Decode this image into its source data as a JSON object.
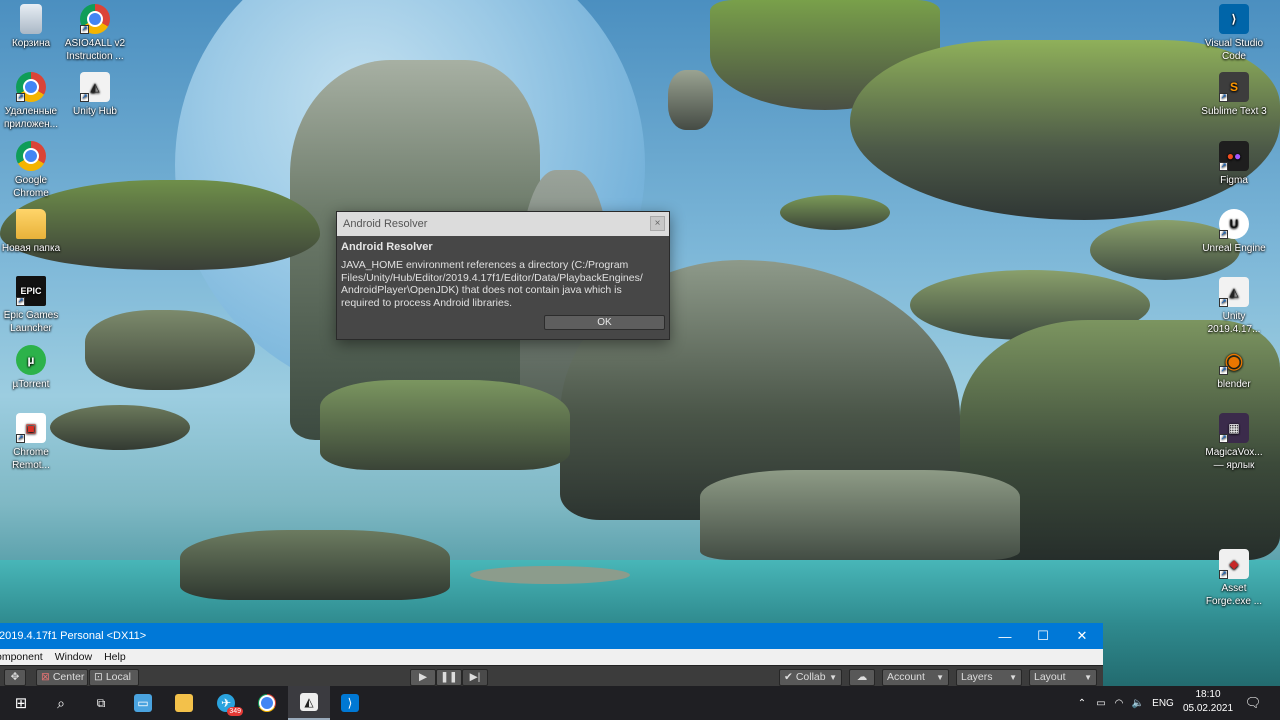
{
  "desktop": {
    "left_icons": [
      {
        "label": "Корзина",
        "icon": "recycle-bin-icon"
      },
      {
        "label": "Удаленные приложен...",
        "icon": "chrome-apps-icon"
      },
      {
        "label": "Google Chrome",
        "icon": "chrome-icon"
      },
      {
        "label": "Новая папка",
        "icon": "folder-icon"
      },
      {
        "label": "Epic Games Launcher",
        "icon": "epic-games-icon"
      },
      {
        "label": "µTorrent",
        "icon": "utorrent-icon"
      },
      {
        "label": "Chrome Remot...",
        "icon": "chrome-remote-icon"
      }
    ],
    "second_column_icons": [
      {
        "label": "ASIO4ALL v2 Instruction ...",
        "icon": "asio-chrome-icon"
      },
      {
        "label": "Unity Hub",
        "icon": "unity-hub-icon"
      }
    ],
    "right_icons": [
      {
        "label": "Visual Studio Code",
        "icon": "vscode-icon"
      },
      {
        "label": "Sublime Text 3",
        "icon": "sublime-icon"
      },
      {
        "label": "Figma",
        "icon": "figma-icon"
      },
      {
        "label": "Unreal Engine",
        "icon": "unreal-icon"
      },
      {
        "label": "Unity 2019.4.17...",
        "icon": "unity-icon"
      },
      {
        "label": "blender",
        "icon": "blender-icon"
      },
      {
        "label": "MagicaVox... — ярлык",
        "icon": "magicavoxel-icon"
      },
      {
        "label": "Asset Forge.exe ...",
        "icon": "asset-forge-icon"
      }
    ]
  },
  "dialog": {
    "window_title": "Android Resolver",
    "heading": "Android Resolver",
    "message": "JAVA_HOME environment references a directory (C:/Program\nFiles/Unity/Hub/Editor/2019.4.17f1/Editor/Data/PlaybackEngines/\nAndroidPlayer\\OpenJDK) that does not contain java which is\nrequired to process Android libraries.",
    "ok_label": "OK",
    "close_glyph": "×"
  },
  "unity": {
    "title": "2019.4.17f1 Personal <DX11>",
    "menu": [
      "omponent",
      "Window",
      "Help"
    ],
    "toolbar": {
      "center_label": "Center",
      "local_label": "Local",
      "collab_label": "Collab",
      "account_label": "Account",
      "layers_label": "Layers",
      "layout_label": "Layout"
    }
  },
  "taskbar": {
    "telegram_badge": "349",
    "language": "ENG",
    "time": "18:10",
    "date": "05.02.2021"
  },
  "colors": {
    "titlebar_blue": "#0078d7",
    "taskbar": "#1f1f23",
    "dialog_bg": "#474747"
  }
}
